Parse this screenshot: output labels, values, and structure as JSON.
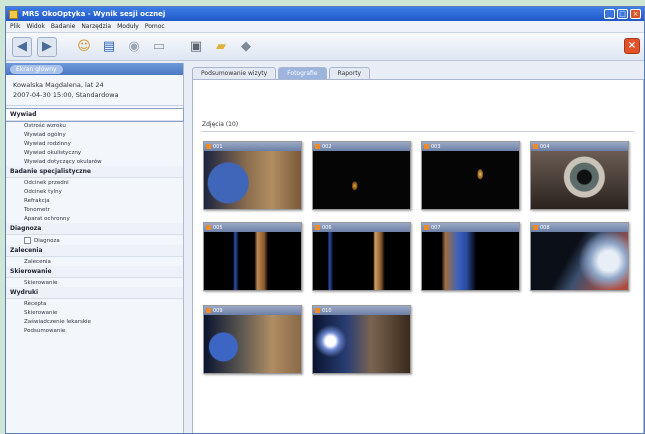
{
  "window": {
    "title": "MRS OkoOptyka - Wynik sesji ocznej",
    "buttons": [
      "_",
      "□",
      "×"
    ]
  },
  "menu": [
    "Plik",
    "Widok",
    "Badanie",
    "Narzędzia",
    "Moduły",
    "Pomoc"
  ],
  "toolbar": {
    "icons": [
      "back-icon",
      "forward-icon",
      "patient-icon",
      "book-icon",
      "eye-icon",
      "print-icon",
      "camera-icon",
      "folder-icon",
      "disk-icon"
    ],
    "exit_label": "×"
  },
  "left": {
    "header": "Ekran główny",
    "patient_name": "Kowalska Magdalena, lat 24",
    "session": "2007-04-30 15:00, Standardowa",
    "groups": [
      {
        "title": "Wywiad",
        "items": [
          "Ostrość wzroku",
          "Wywiad ogólny",
          "Wywiad rodzinny",
          "Wywiad okulistyczny",
          "Wywiad dotyczący okularów"
        ]
      },
      {
        "title": "Badanie specjalistyczne",
        "items": [
          "Odcinek przedni",
          "Odcinek tylny",
          "Refrakcja",
          "Tonometr",
          "Aparat ochronny"
        ]
      },
      {
        "title": "Diagnoza",
        "items": [
          "Diagnoza"
        ]
      },
      {
        "title": "Zalecenia",
        "items": [
          "Zalecenia"
        ]
      },
      {
        "title": "Skierowanie",
        "items": [
          "Skierowanie"
        ]
      },
      {
        "title": "Wydruki",
        "items": [
          "Recepta",
          "Skierowanie",
          "Zaświadczenie lekarskie",
          "Podsumowanie"
        ]
      }
    ]
  },
  "tabs": [
    "Podsumowanie wizyty",
    "Fotografie",
    "Raporty"
  ],
  "section": {
    "title": "Zdjęcia (10)"
  },
  "thumbnails": [
    {
      "label": "001"
    },
    {
      "label": "002"
    },
    {
      "label": "003"
    },
    {
      "label": "004"
    },
    {
      "label": "005"
    },
    {
      "label": "006"
    },
    {
      "label": "007"
    },
    {
      "label": "008"
    },
    {
      "label": "009"
    },
    {
      "label": "010"
    }
  ],
  "colors": {
    "titlebar": "#1f58c8",
    "accent": "#4a78c4",
    "exit": "#e2522a"
  }
}
